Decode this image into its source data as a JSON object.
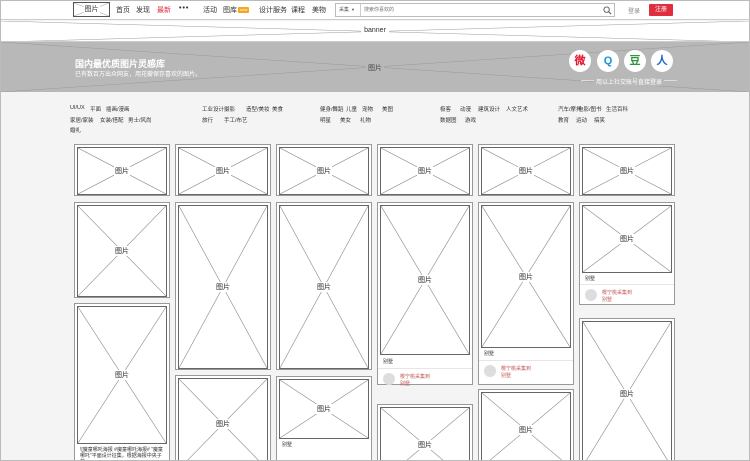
{
  "nav": {
    "logo": "图片",
    "items": [
      {
        "label": "首页",
        "active": false
      },
      {
        "label": "发现",
        "active": false
      },
      {
        "label": "最新",
        "active": true
      },
      {
        "label": "•••",
        "active": false
      },
      {
        "label": "活动",
        "active": false
      },
      {
        "label": "图库",
        "active": false,
        "badge": "new"
      },
      {
        "label": "设计服务",
        "active": false
      },
      {
        "label": "课程",
        "active": false
      },
      {
        "label": "美物",
        "active": false
      }
    ],
    "search_category": "采集",
    "search_placeholder": "搜索你喜欢的",
    "login": "登录",
    "register": "注册"
  },
  "banner": {
    "label": "banner"
  },
  "hero": {
    "title": "国内最优质图片灵感库",
    "subtitle": "已有数百万出众网友，用花瓣保存喜欢的图片。",
    "placeholder": "图片",
    "social_login_text": "用以上社交账号直接登录",
    "social": [
      {
        "name": "weibo-icon",
        "glyph": "微",
        "color": "#e6162d"
      },
      {
        "name": "qq-icon",
        "glyph": "Q",
        "color": "#1296db"
      },
      {
        "name": "douban-icon",
        "glyph": "豆",
        "color": "#2e963d"
      },
      {
        "name": "renren-icon",
        "glyph": "人",
        "color": "#1c68c8"
      }
    ]
  },
  "categories": [
    [
      "UI/UX",
      "平面",
      "插画/漫画",
      "家居/家装",
      "女装/搭配",
      "男士/风尚",
      "婚礼"
    ],
    [
      "工业设计",
      "摄影",
      "造型/美妆",
      "美食",
      "旅行",
      "手工/布艺"
    ],
    [
      "健身/舞蹈",
      "儿童",
      "宠物",
      "美图",
      "明星",
      "美女",
      "礼物"
    ],
    [
      "极客",
      "动漫",
      "建筑设计",
      "人文艺术",
      "数据图",
      "游戏"
    ],
    [
      "汽车/摩托",
      "电影/图书",
      "生活百科",
      "教育",
      "运动",
      "搞笑"
    ]
  ],
  "cards": [
    {
      "placeholder": "图片"
    },
    {
      "placeholder": "图片"
    },
    {
      "placeholder": "图片",
      "title": "![魔童哪吒海报 #魔童哪吒海报# \"魔童哪吒\"平面设计征集，根据海报中央子的"
    },
    {
      "placeholder": "图片"
    },
    {
      "placeholder": "图片"
    },
    {
      "placeholder": "图片"
    },
    {
      "placeholder": "图片"
    },
    {
      "placeholder": "图片"
    },
    {
      "placeholder": "图片",
      "title": "别墅"
    },
    {
      "placeholder": "图片"
    },
    {
      "placeholder": "图片",
      "title": "别墅",
      "user": "樱宁桃采集到",
      "board": "别墅"
    },
    {
      "placeholder": "图片"
    },
    {
      "placeholder": "图片"
    },
    {
      "placeholder": "图片",
      "title": "别墅",
      "user": "樱宁桃采集到",
      "board": "别墅"
    },
    {
      "placeholder": "图片"
    },
    {
      "placeholder": "图片"
    },
    {
      "placeholder": "图片",
      "title": "别墅",
      "user": "樱宁桃采集到",
      "board": "别墅"
    },
    {
      "placeholder": "图片"
    }
  ]
}
